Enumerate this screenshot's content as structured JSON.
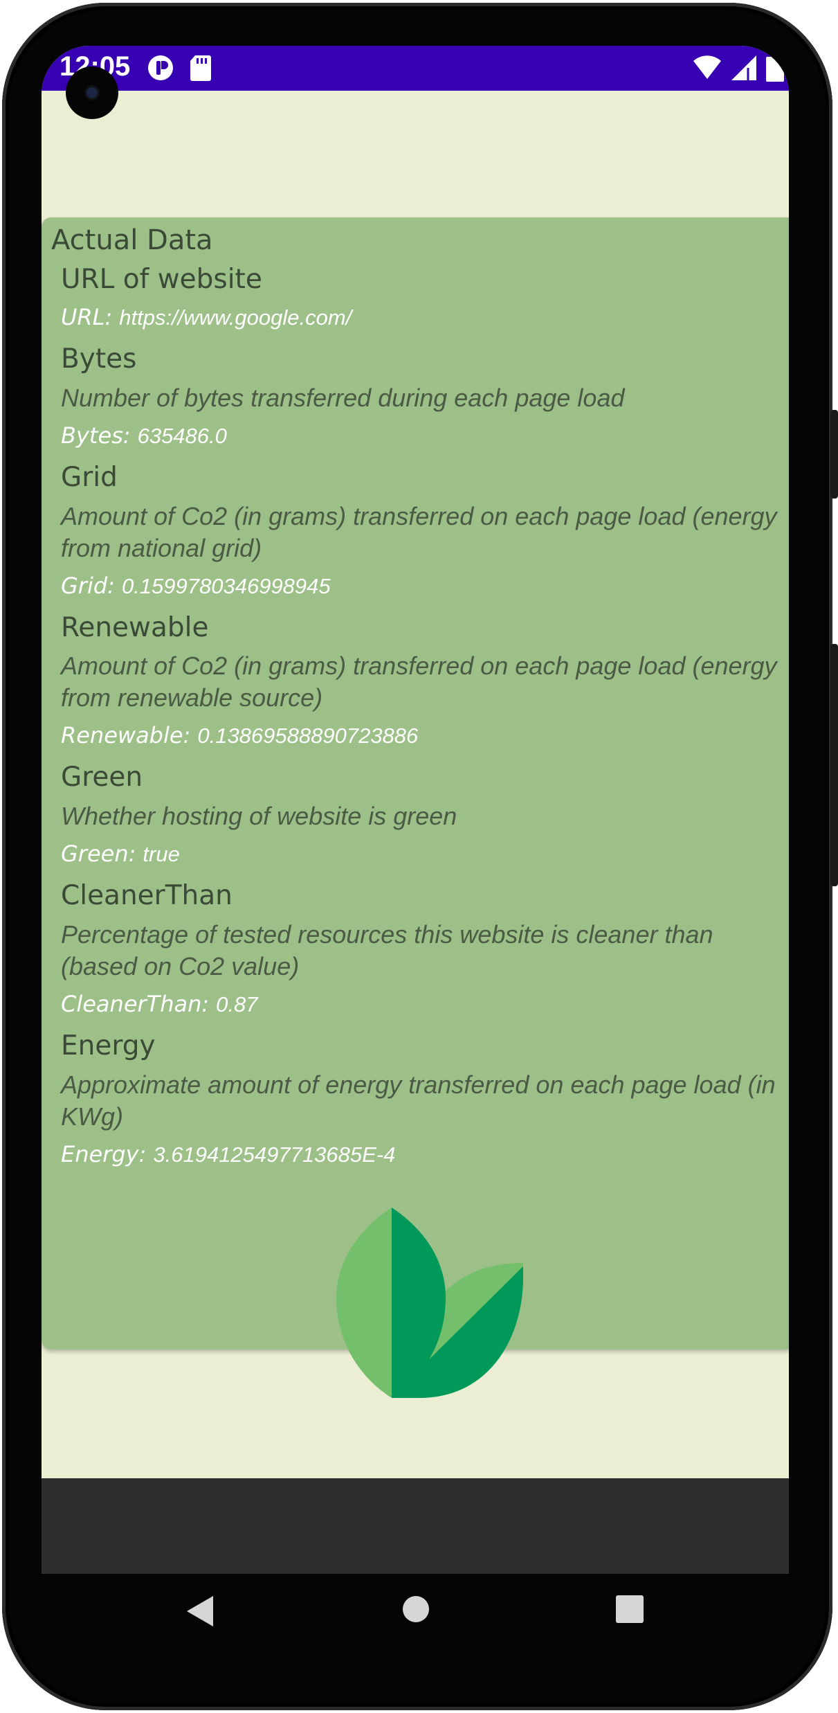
{
  "status_bar": {
    "time": "12:05",
    "icons": [
      "info-circle-icon",
      "sd-card-icon",
      "wifi-icon",
      "signal-icon",
      "battery-icon"
    ],
    "color": "#3700b3"
  },
  "card": {
    "title": "Actual Data",
    "background": "#9dc089",
    "sections": [
      {
        "heading": "URL of website",
        "description": "",
        "value_label": "URL:",
        "value": "https://www.google.com/"
      },
      {
        "heading": "Bytes",
        "description": "Number of bytes transferred during each page load",
        "value_label": "Bytes:",
        "value": "635486.0"
      },
      {
        "heading": "Grid",
        "description": "Amount of Co2 (in grams) transferred on each page load (energy from national grid)",
        "value_label": "Grid:",
        "value": "0.1599780346998945"
      },
      {
        "heading": "Renewable",
        "description": "Amount of Co2 (in grams) transferred on each page load (energy from renewable source)",
        "value_label": "Renewable:",
        "value": "0.13869588890723886"
      },
      {
        "heading": "Green",
        "description": "Whether hosting of website is green",
        "value_label": "Green:",
        "value": "true"
      },
      {
        "heading": "CleanerThan",
        "description": "Percentage of tested resources this website is cleaner than (based on Co2 value)",
        "value_label": "CleanerThan:",
        "value": "0.87"
      },
      {
        "heading": "Energy",
        "description": "Approximate amount of energy transferred on each page load (in KWg)",
        "value_label": "Energy:",
        "value": "3.6194125497713685E-4"
      }
    ],
    "logo_icon": "leaf-icon"
  },
  "nav": {
    "back_icon": "back-triangle-icon",
    "home_icon": "home-circle-icon",
    "recents_icon": "recents-square-icon"
  }
}
